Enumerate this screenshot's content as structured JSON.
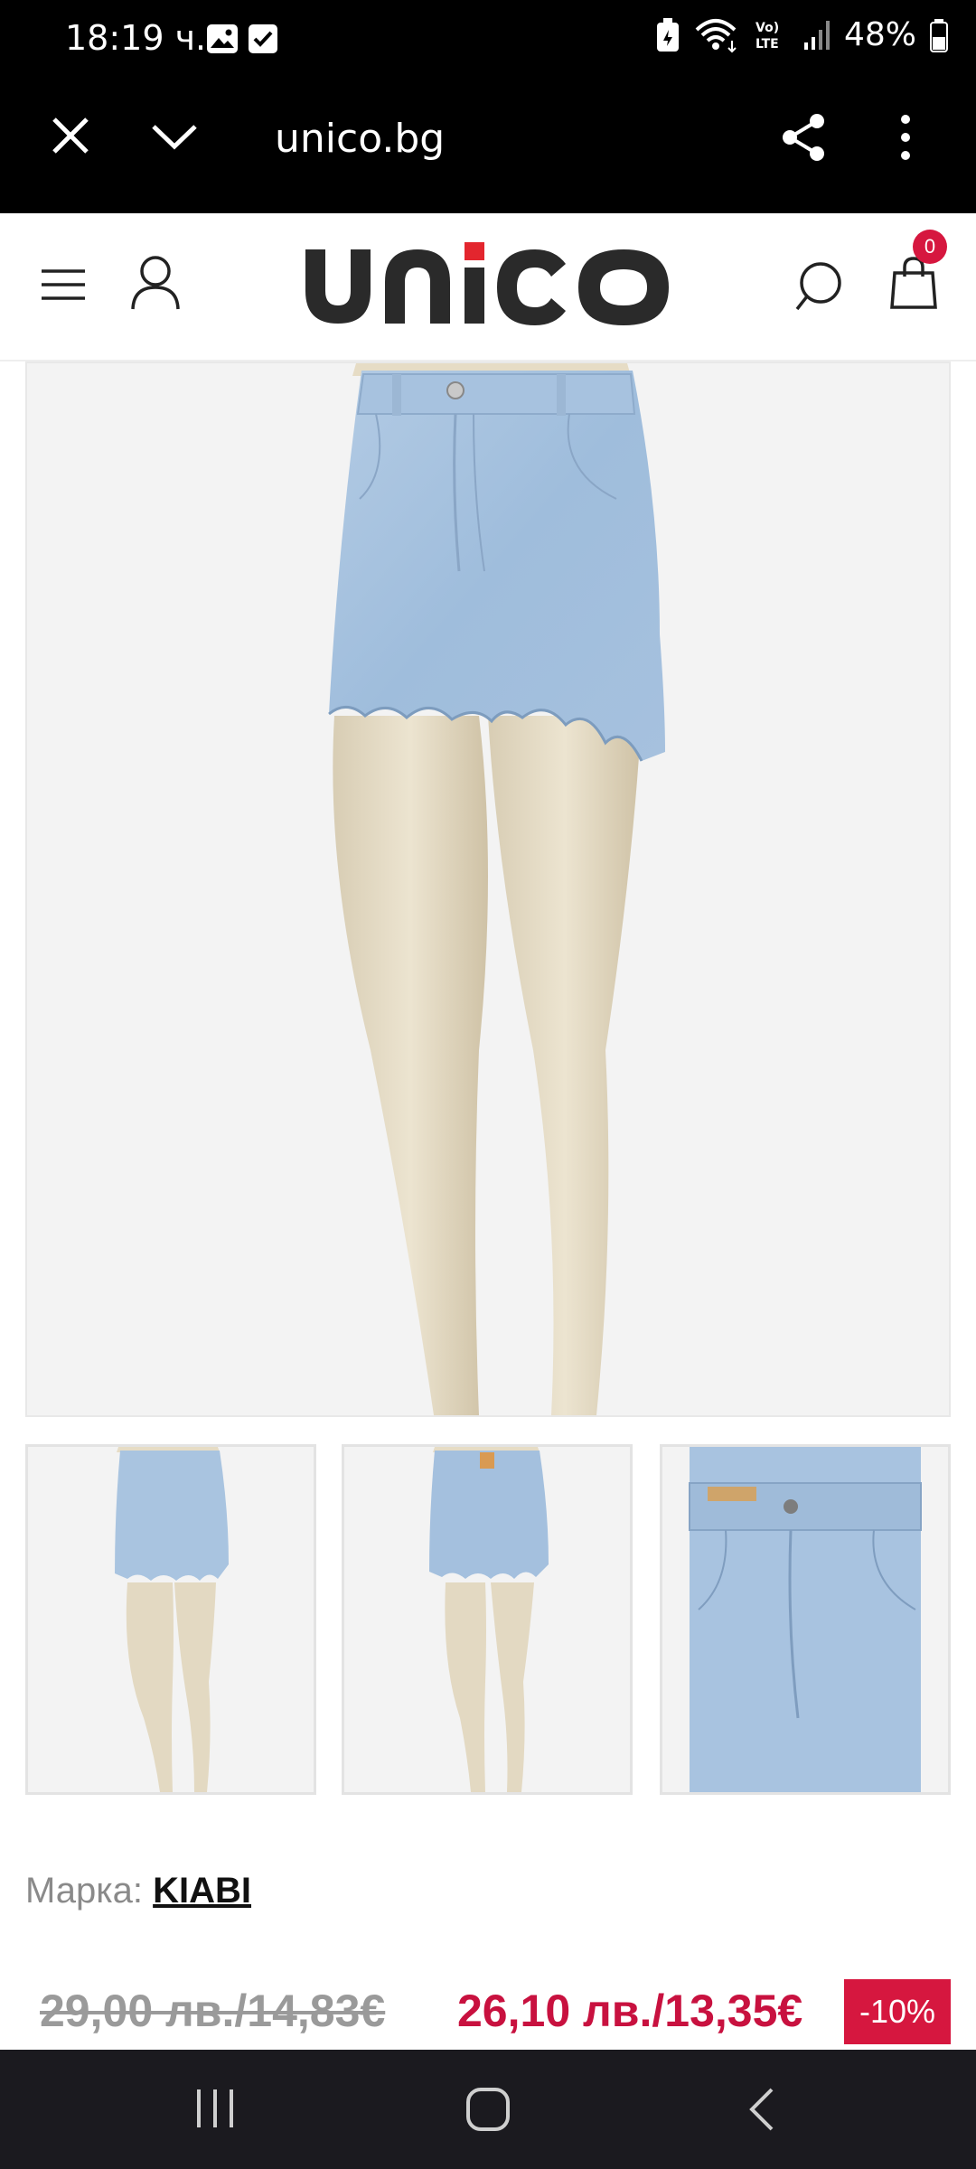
{
  "status_bar": {
    "time": "18:19 ч.",
    "battery": "48%",
    "icons": [
      "gallery-icon",
      "checkbox-icon",
      "data-saver-icon",
      "wifi-icon",
      "volte-icon",
      "signal-icon",
      "battery-icon"
    ]
  },
  "browser": {
    "url": "unico.bg",
    "icons": [
      "close-icon",
      "chevron-down-icon",
      "share-icon",
      "more-vert-icon"
    ]
  },
  "header": {
    "logo_text": "unico",
    "cart_count": "0",
    "icons": [
      "menu-icon",
      "user-icon",
      "search-icon",
      "cart-icon"
    ]
  },
  "product": {
    "brand_label": "Марка:",
    "brand_name": "KIABI",
    "old_price": "29,00 лв./14,83€",
    "new_price": "26,10 лв./13,35€",
    "discount": "-10%"
  },
  "colors": {
    "accent": "#d6173f",
    "price": "#c8113f",
    "denim": "#a9c4e0"
  },
  "nav_bar": {
    "icons": [
      "recents-icon",
      "home-icon",
      "back-icon"
    ]
  }
}
